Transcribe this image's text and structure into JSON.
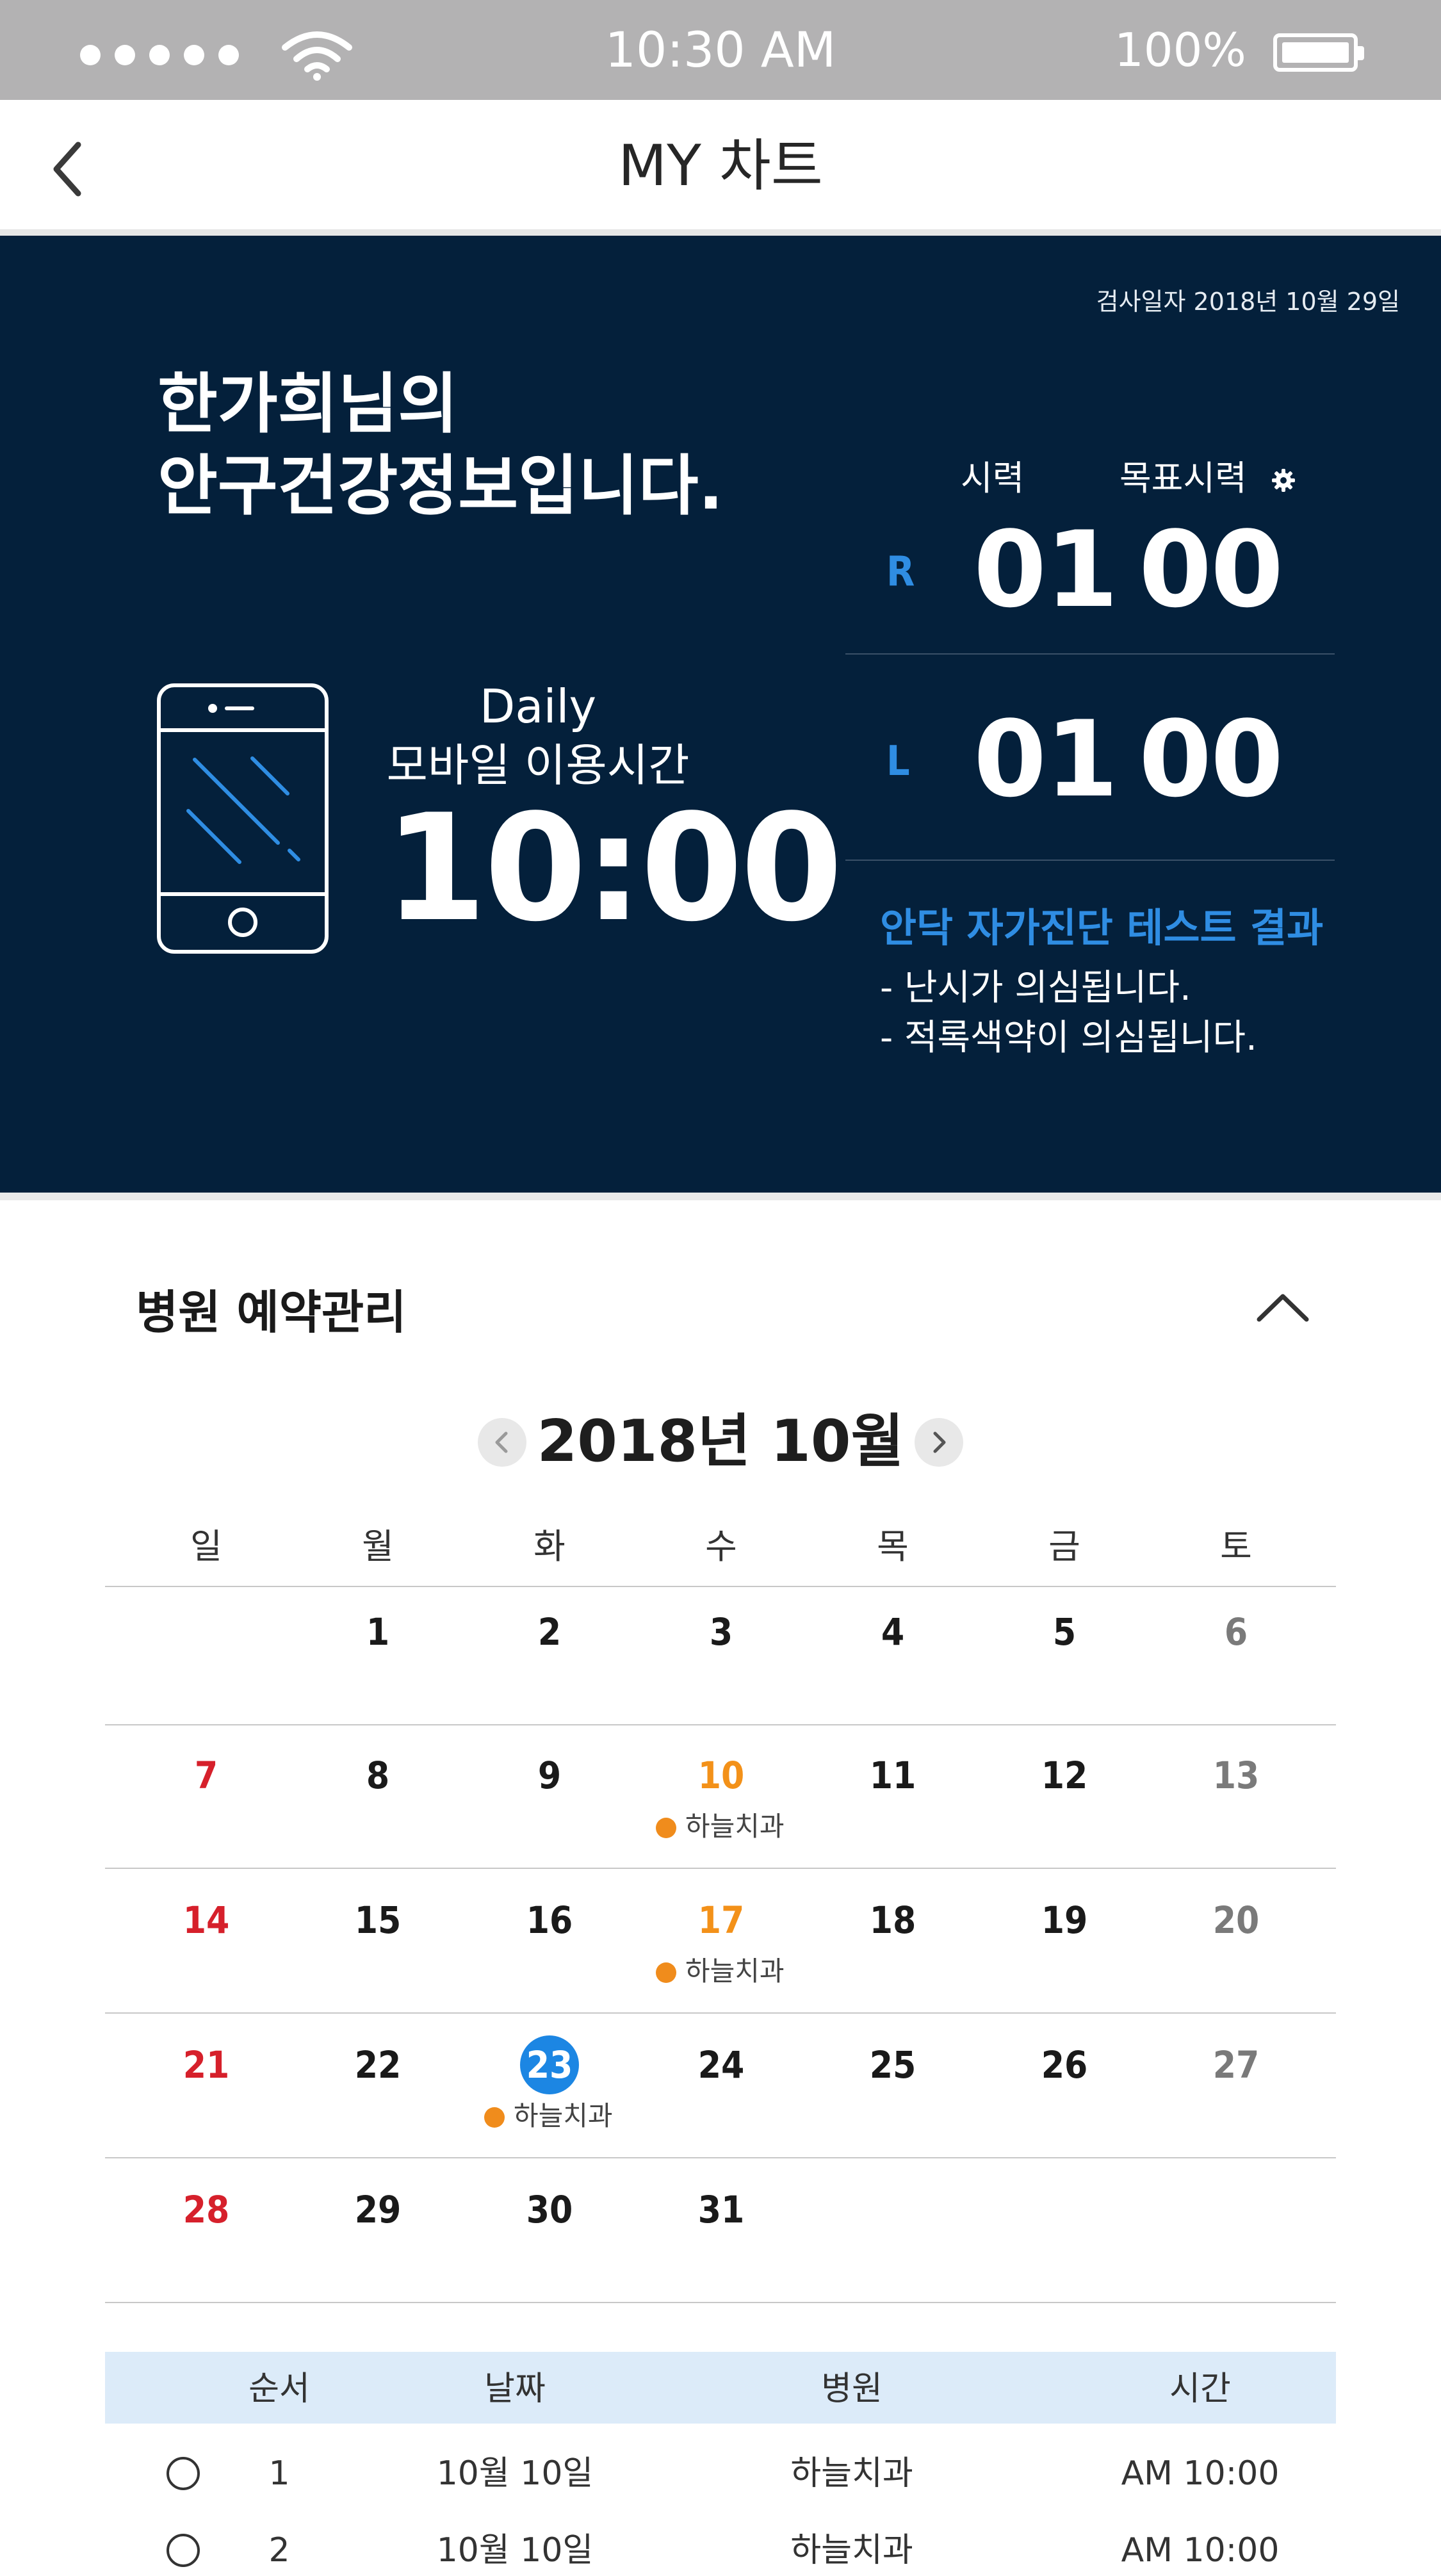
{
  "status_bar": {
    "time": "10:30 AM",
    "battery_percent": "100%",
    "signal_icon": "signal-dots-icon",
    "wifi_icon": "wifi-icon",
    "battery_icon": "battery-icon"
  },
  "nav": {
    "title": "MY 차트",
    "back_icon": "chevron-left-icon"
  },
  "hero": {
    "exam_date": "검사일자  2018년 10월 29일",
    "greeting_line1": "한가희님의",
    "greeting_line2": "안구건강정보입니다.",
    "daily_label": "Daily",
    "mobile_usage_label": "모바일 이용시간",
    "mobile_usage_time": "10:00",
    "phone_icon": "smartphone-icon",
    "vision_header": "시력",
    "target_vision_header": "목표시력",
    "settings_icon": "gear-icon",
    "right_eye": {
      "label": "R",
      "vision": "01",
      "target": "00"
    },
    "left_eye": {
      "label": "L",
      "vision": "01",
      "target": "00"
    },
    "test_title": "안닥 자가진단 테스트 결과",
    "test_results": [
      "- 난시가 의심됩니다.",
      "- 적록색약이 의심됩니다."
    ]
  },
  "section": {
    "title": "병원 예약관리",
    "collapse_icon": "chevron-up-icon"
  },
  "calendar": {
    "month_title": "2018년 10월",
    "prev_icon": "chevron-left-icon",
    "next_icon": "chevron-right-icon",
    "weekdays": [
      "일",
      "월",
      "화",
      "수",
      "목",
      "금",
      "토"
    ],
    "selected_day": "23",
    "weeks": [
      [
        "",
        "1",
        "2",
        "3",
        "4",
        "5",
        "6"
      ],
      [
        "7",
        "8",
        "9",
        "10",
        "11",
        "12",
        "13"
      ],
      [
        "14",
        "15",
        "16",
        "17",
        "18",
        "19",
        "20"
      ],
      [
        "21",
        "22",
        "23",
        "24",
        "25",
        "26",
        "27"
      ],
      [
        "28",
        "29",
        "30",
        "31",
        "",
        "",
        ""
      ]
    ],
    "events": [
      {
        "day": "10",
        "label": "하늘치과"
      },
      {
        "day": "17",
        "label": "하늘치과"
      },
      {
        "day": "23",
        "label": "하늘치과"
      }
    ],
    "colors": {
      "sunday": "#d6202b",
      "saturday": "#7a7a7a",
      "appointment": "#f39119",
      "selected": "#1c86e3"
    }
  },
  "table": {
    "headers": [
      "순서",
      "날짜",
      "병원",
      "시간"
    ],
    "rows": [
      {
        "order": "1",
        "date": "10월 10일",
        "hospital": "하늘치과",
        "time": "AM 10:00"
      },
      {
        "order": "2",
        "date": "10월 10일",
        "hospital": "하늘치과",
        "time": "AM 10:00"
      }
    ]
  }
}
